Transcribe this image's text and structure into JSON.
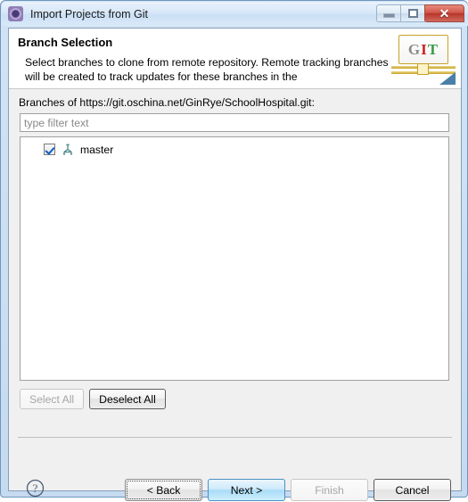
{
  "window": {
    "title": "Import Projects from Git",
    "app_icon": "eclipse-import-icon",
    "controls": {
      "minimize": "minimize-icon",
      "maximize": "maximize-icon",
      "close": "✕"
    }
  },
  "banner": {
    "title": "Branch Selection",
    "description": "Select branches to clone from remote repository. Remote tracking branches will be created to track updates for these branches in the",
    "logo": {
      "g": "G",
      "i": "I",
      "t": "T"
    }
  },
  "content": {
    "branches_label": "Branches of https://git.oschina.net/GinRye/SchoolHospital.git:",
    "filter": {
      "value": "",
      "placeholder": "type filter text"
    },
    "branches": [
      {
        "name": "master",
        "checked": true,
        "icon": "git-branch-icon"
      }
    ],
    "select_all_label": "Select All",
    "select_all_enabled": false,
    "deselect_all_label": "Deselect All",
    "deselect_all_enabled": true
  },
  "footer": {
    "help_label": "?",
    "back_label": "< Back",
    "next_label": "Next >",
    "finish_label": "Finish",
    "finish_enabled": false,
    "cancel_label": "Cancel"
  },
  "colors": {
    "accent_blue": "#a9dcf7",
    "frame_blue": "#6f96bd",
    "close_red": "#b8352a",
    "git_green": "#3a9b4a",
    "git_red": "#cc2222",
    "git_gold": "#c9a227",
    "check_blue": "#0b5fbf"
  }
}
